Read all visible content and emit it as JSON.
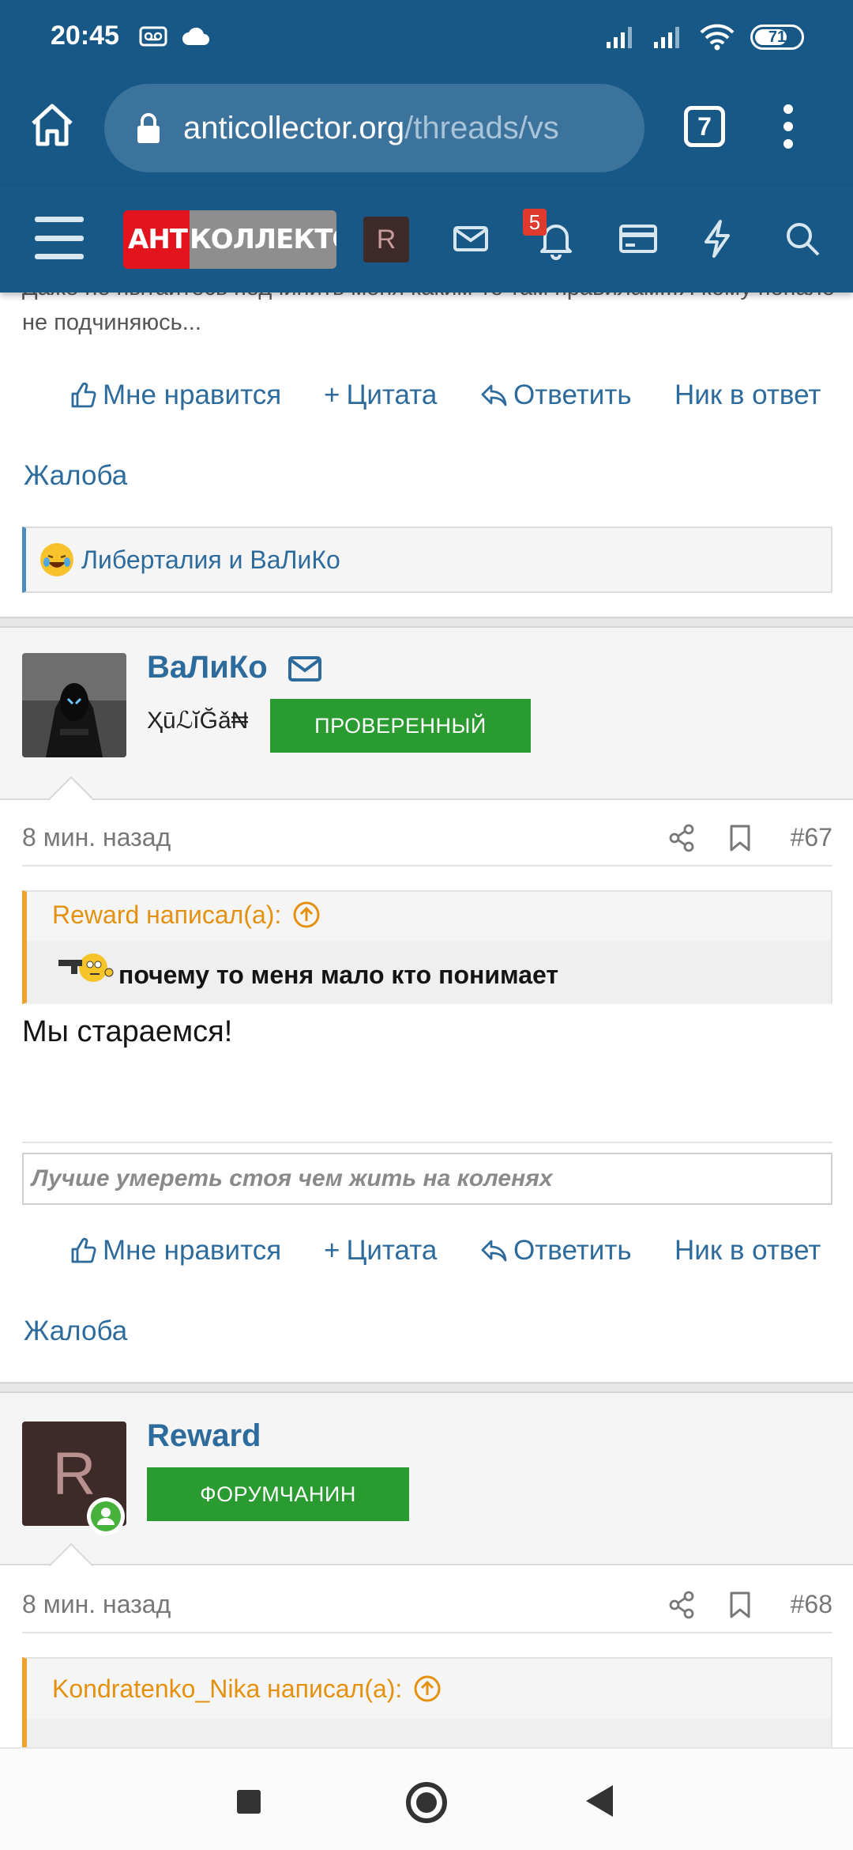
{
  "status": {
    "time": "20:45",
    "battery": "71",
    "battery_level": 0.71
  },
  "browser": {
    "url_domain": "anticollector.org",
    "url_path": "/threads/vs",
    "tab_count": "7"
  },
  "site": {
    "logo_part1": "АНТИ",
    "logo_part2": "КОЛЛЕКТОР",
    "avatar_letter": "R",
    "notifications_count": "5"
  },
  "prev_post": {
    "cut_text": "Даже не пытайтесь подчинить меня каким-то там правилам...Я кому попало не подчиняюсь...",
    "actions": {
      "like": "Мне нравится",
      "quote": "Цитата",
      "reply": "Ответить",
      "nick": "Ник в ответ",
      "report": "Жалоба"
    },
    "reactions": "Либерталия и ВаЛиКо"
  },
  "post67": {
    "username": "ВаЛиКо",
    "user_title": "ҲūℒĭĞǎ₦",
    "role": "ПРОВЕРЕННЫЙ",
    "time": "8 мин. назад",
    "number": "#67",
    "quote_author": "Reward написал(а):",
    "quote_text": "почему то меня мало кто понимает",
    "text": "Мы стараемся!",
    "signature": "Лучше умереть стоя чем жить на коленях",
    "actions": {
      "like": "Мне нравится",
      "quote": "Цитата",
      "reply": "Ответить",
      "nick": "Ник в ответ",
      "report": "Жалоба"
    }
  },
  "post68": {
    "username": "Reward",
    "avatar_letter": "R",
    "role": "ФОРУМЧАНИН",
    "time": "8 мин. назад",
    "number": "#68",
    "quote_author": "Kondratenko_Nika написал(а):"
  },
  "colors": {
    "header": "#185886",
    "link": "#2d6b9c",
    "badge_green": "#2a9b30",
    "quote_accent": "#f0a22f"
  }
}
